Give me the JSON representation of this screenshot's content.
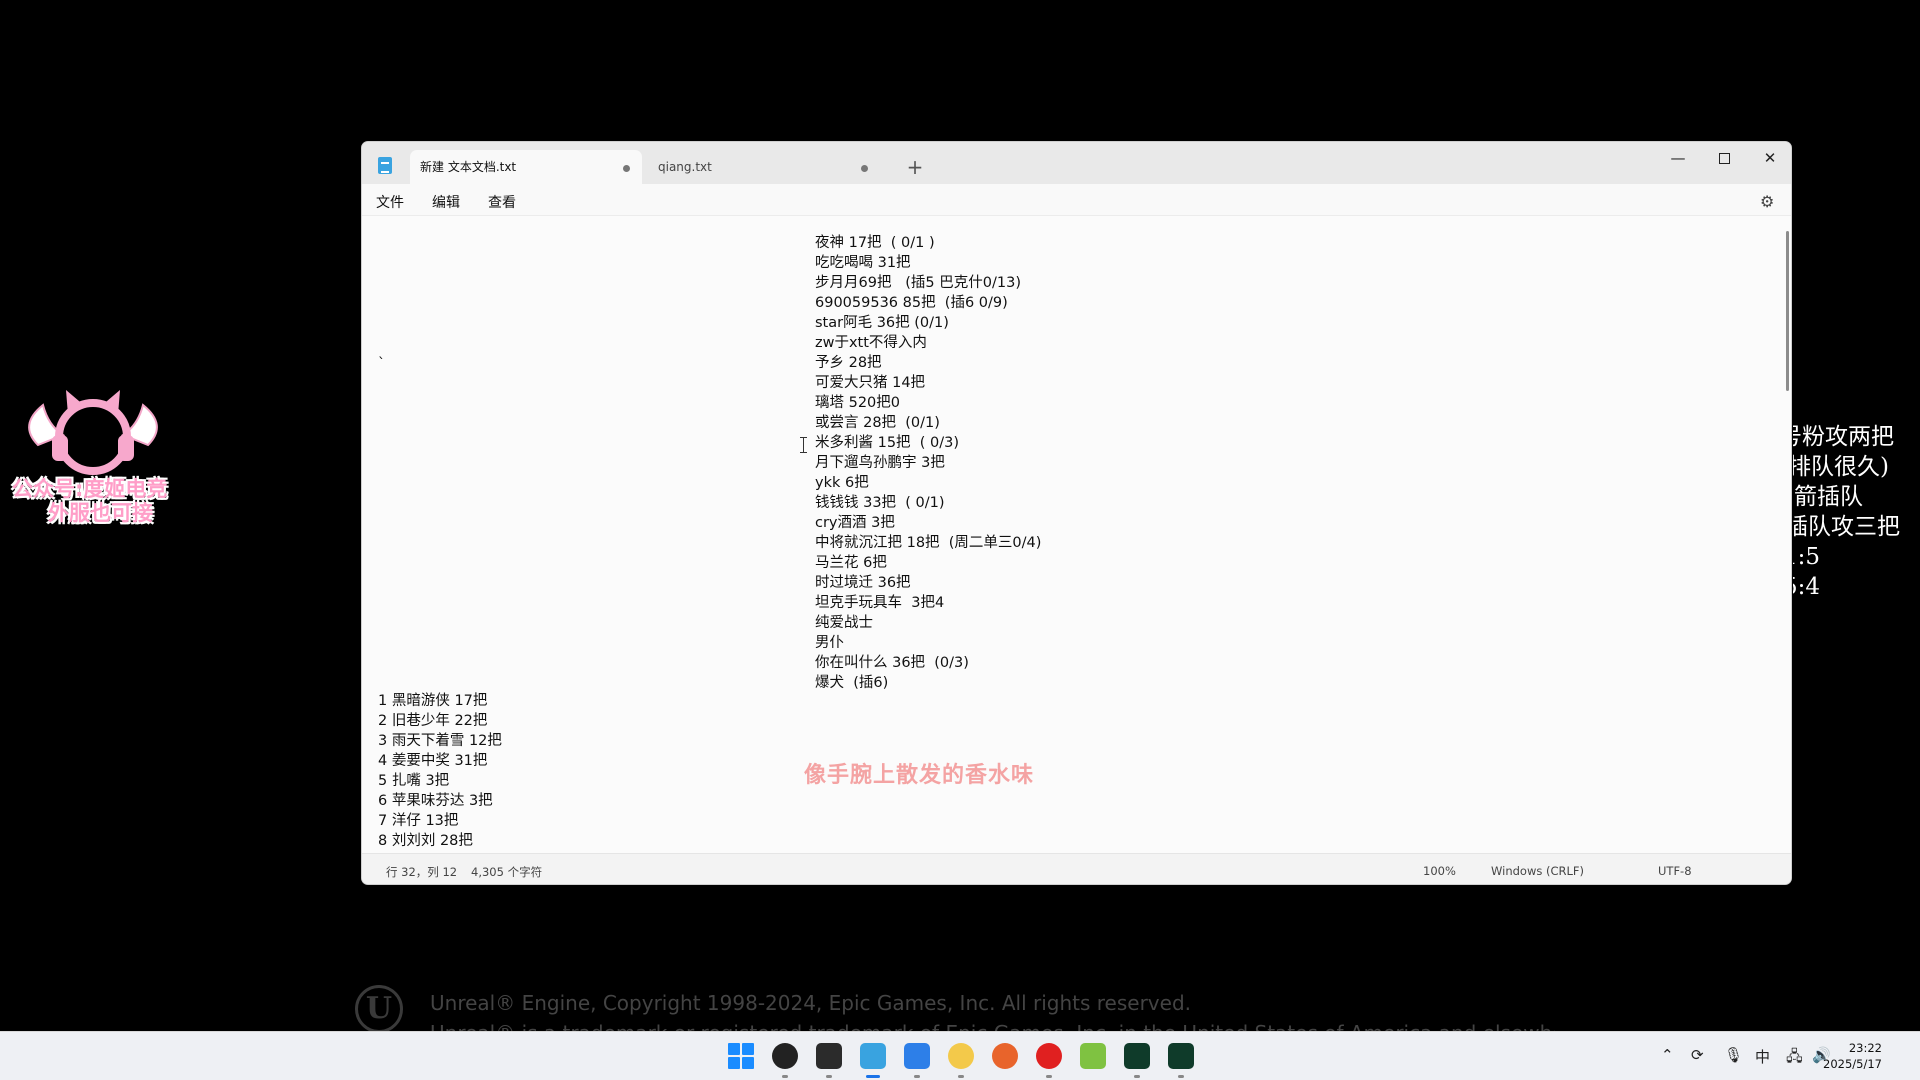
{
  "overlay": {
    "logo_line1": "公众号:度姬电竞",
    "logo_line2": "外服也可接",
    "right_lines": [
      "号粉攻两把",
      "(排队很久)",
      "(箭插队",
      "插队攻三把",
      "1:5",
      "5:4"
    ]
  },
  "window": {
    "tabs": [
      {
        "label": "新建 文本文档.txt",
        "active": true
      },
      {
        "label": "qiang.txt",
        "active": false
      }
    ],
    "new_tab": "+",
    "controls": {
      "minimize": "—",
      "maximize": "",
      "close": "✕"
    }
  },
  "menu": {
    "file": "文件",
    "edit": "编辑",
    "view": "查看"
  },
  "editor": {
    "backtick": "`",
    "center_lines": [
      "夜神 17把  ( 0/1 )",
      "吃吃喝喝 31把",
      "步月月69把   (插5 巴克什0/13)",
      "690059536 85把  (插6 0/9)",
      "star阿毛 36把 (0/1)",
      "zw于xtt不得入内",
      "予乡 28把",
      "可爱大只猪 14把",
      "璃塔 520把0",
      "或尝言 28把  (0/1)",
      "米多利酱 15把  ( 0/3)",
      "月下遛鸟孙鹏宇 3把",
      "ykk 6把",
      "钱钱钱 33把  ( 0/1)",
      "cry酒酒 3把",
      "中将就沉江把 18把  (周二单三0/4)",
      "马兰花 6把",
      "时过境迁 36把",
      "坦克手玩具车  3把4",
      "纯爱战士",
      "男仆",
      "你在叫什么 36把  (0/3)",
      "爆犬  (插6)"
    ],
    "left_lines": [
      "1 黑暗游侠 17把",
      "2 旧巷少年 22把",
      "3 雨天下着雪 12把",
      "4 姜要中奖 31把",
      "5 扎嘴 3把",
      "6 苹果味芬达 3把",
      "7 洋仔 13把",
      "8 刘刘刘 28把"
    ],
    "watermark": "像手腕上散发的香水味"
  },
  "status": {
    "position": "行 32，列 12",
    "chars": "4,305 个字符",
    "zoom": "100%",
    "eol": "Windows (CRLF)",
    "encoding": "UTF-8"
  },
  "footer": {
    "logo": "U",
    "line1": "Unreal® Engine, Copyright 1998-2024, Epic Games, Inc. All rights reserved.",
    "line2": "Unreal® is a trademark or registered trademark of Epic Games, Inc. in the United States of America and elsewhere."
  },
  "taskbar": {
    "ime": "中",
    "time": "23:22",
    "date": "2025/5/17"
  }
}
